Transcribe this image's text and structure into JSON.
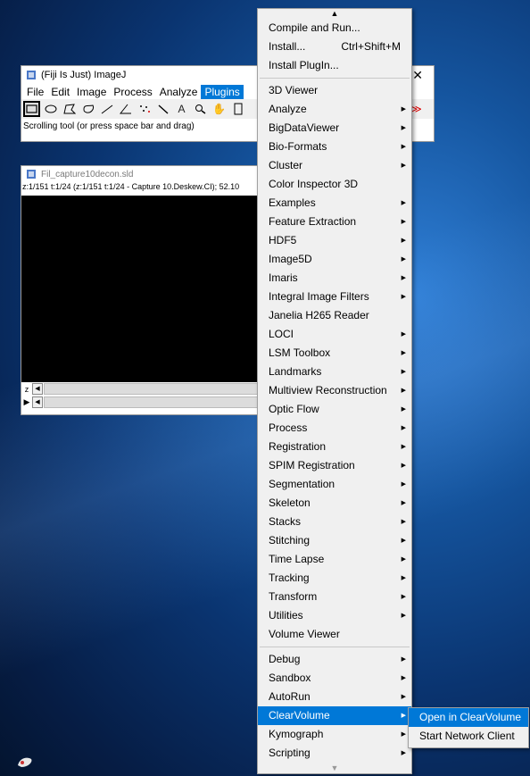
{
  "imagej": {
    "title": "(Fiji Is Just) ImageJ",
    "close": "✕",
    "menubar": [
      "File",
      "Edit",
      "Image",
      "Process",
      "Analyze",
      "Plugins"
    ],
    "active_menu": "Plugins",
    "status": "Scrolling tool (or press space bar and drag)",
    "more_tools": "≫"
  },
  "image_window": {
    "title": "Fil_capture10decon.sld",
    "info": "z:1/151 t:1/24 (z:1/151 t:1/24 - Capture 10.Deskew.CI); 52.10",
    "z_label": "z",
    "t_label": "▶"
  },
  "plugins_menu": {
    "group1": [
      {
        "label": "Compile and Run...",
        "sub": false
      },
      {
        "label": "Install...",
        "accel": "Ctrl+Shift+M",
        "sub": false
      },
      {
        "label": "Install PlugIn...",
        "sub": false
      }
    ],
    "group2": [
      {
        "label": "3D Viewer",
        "sub": false
      },
      {
        "label": "Analyze",
        "sub": true
      },
      {
        "label": "BigDataViewer",
        "sub": true
      },
      {
        "label": "Bio-Formats",
        "sub": true
      },
      {
        "label": "Cluster",
        "sub": true
      },
      {
        "label": "Color Inspector 3D",
        "sub": false
      },
      {
        "label": "Examples",
        "sub": true
      },
      {
        "label": "Feature Extraction",
        "sub": true
      },
      {
        "label": "HDF5",
        "sub": true
      },
      {
        "label": "Image5D",
        "sub": true
      },
      {
        "label": "Imaris",
        "sub": true
      },
      {
        "label": "Integral Image Filters",
        "sub": true
      },
      {
        "label": "Janelia H265 Reader",
        "sub": false
      },
      {
        "label": "LOCI",
        "sub": true
      },
      {
        "label": "LSM Toolbox",
        "sub": true
      },
      {
        "label": "Landmarks",
        "sub": true
      },
      {
        "label": "Multiview Reconstruction",
        "sub": true
      },
      {
        "label": "Optic Flow",
        "sub": true
      },
      {
        "label": "Process",
        "sub": true
      },
      {
        "label": "Registration",
        "sub": true
      },
      {
        "label": "SPIM Registration",
        "sub": true
      },
      {
        "label": "Segmentation",
        "sub": true
      },
      {
        "label": "Skeleton",
        "sub": true
      },
      {
        "label": "Stacks",
        "sub": true
      },
      {
        "label": "Stitching",
        "sub": true
      },
      {
        "label": "Time Lapse",
        "sub": true
      },
      {
        "label": "Tracking",
        "sub": true
      },
      {
        "label": "Transform",
        "sub": true
      },
      {
        "label": "Utilities",
        "sub": true
      },
      {
        "label": "Volume Viewer",
        "sub": false
      }
    ],
    "group3": [
      {
        "label": "Debug",
        "sub": true
      },
      {
        "label": "Sandbox",
        "sub": true
      },
      {
        "label": "AutoRun",
        "sub": true
      },
      {
        "label": "ClearVolume",
        "sub": true,
        "highlighted": true
      },
      {
        "label": "Kymograph",
        "sub": true
      },
      {
        "label": "Scripting",
        "sub": true
      }
    ]
  },
  "clearvolume_submenu": [
    {
      "label": "Open in ClearVolume",
      "highlighted": true
    },
    {
      "label": "Start Network Client",
      "highlighted": false
    }
  ],
  "colors": {
    "highlight": "#0078d7",
    "menu_bg": "#f0f0f0"
  }
}
